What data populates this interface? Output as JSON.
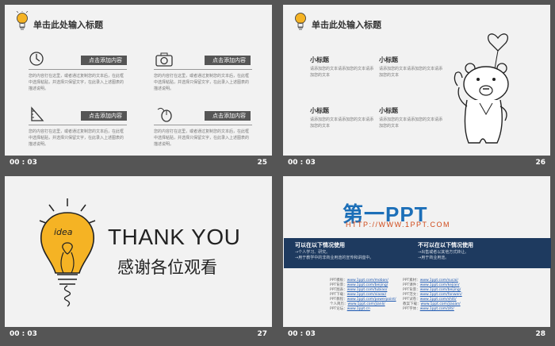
{
  "slides": [
    {
      "id": 25,
      "time": "00 : 03",
      "number": "25",
      "title": "单击此处输入标题",
      "features": [
        {
          "icon": "clock-icon",
          "tag": "点击添加内容",
          "text": "您的内容打在这里，或者通过复制您的文本后，在此框中选择粘贴，并选择只保留文字，在此录入上述图表的描述说明。"
        },
        {
          "icon": "camera-icon",
          "tag": "点击添加内容",
          "text": "您的内容打在这里，或者通过复制您的文本后，在此框中选择粘贴，并选择只保留文字，在此录入上述图表的描述说明。"
        },
        {
          "icon": "ruler-pencil-icon",
          "tag": "点击添加内容",
          "text": "您的内容打在这里，或者通过复制您的文本后，在此框中选择粘贴，并选择只保留文字，在此录入上述图表的描述说明。"
        },
        {
          "icon": "mouse-icon",
          "tag": "点击添加内容",
          "text": "您的内容打在这里，或者通过复制您的文本后，在此框中选择粘贴，并选择只保留文字，在此录入上述图表的描述说明。"
        }
      ]
    },
    {
      "id": 26,
      "time": "00 : 03",
      "number": "26",
      "title": "单击此处输入标题",
      "subs": [
        {
          "title": "小标题",
          "text": "请添加您的文本请添加您的文本请添加您的文本"
        },
        {
          "title": "小标题",
          "text": "请添加您的文本请添加您的文本请添加您的文本"
        },
        {
          "title": "小标题",
          "text": "请添加您的文本请添加您的文本请添加您的文本"
        },
        {
          "title": "小标题",
          "text": "请添加您的文本请添加您的文本请添加您的文本"
        }
      ]
    },
    {
      "id": 27,
      "time": "00 : 03",
      "number": "27",
      "thanks_en": "THANK YOU",
      "thanks_cn": "感谢各位观看",
      "bulb_word": "idea"
    },
    {
      "id": 28,
      "time": "00 : 03",
      "number": "28",
      "logo": "第一PPT",
      "url": "HTTP://WWW.1PPT.COM",
      "left_head": "可以在以下情况使用",
      "left_text": "→个人学习、研究。\n→用于教学中的非商业用途的宣传和讲座中。",
      "right_head": "不可以在以下情况使用",
      "right_text": "→出售或者以其他方式转让。\n→用于商业用途。",
      "links_left": [
        {
          "label": "PPT模板：",
          "url": "www.1ppt.com/moban/"
        },
        {
          "label": "PPT背景：",
          "url": "www.1ppt.com/beijing/"
        },
        {
          "label": "PPT图表：",
          "url": "www.1ppt.com/tubiao/"
        },
        {
          "label": "PPT下载：",
          "url": "www.1ppt.com/xiazai/"
        },
        {
          "label": "PPT教程：",
          "url": "www.1ppt.com/powerpoint/"
        },
        {
          "label": "个人简历：",
          "url": "www.1ppt.com/jianli/"
        },
        {
          "label": "PPT论坛：",
          "url": "www.1ppt.cn"
        }
      ],
      "links_right": [
        {
          "label": "PPT素材：",
          "url": "www.1ppt.com/sucai/"
        },
        {
          "label": "PPT课件：",
          "url": "www.1ppt.com/kejian/"
        },
        {
          "label": "PPT背景：",
          "url": "www.1ppt.com/beijing/"
        },
        {
          "label": "PPT范文：",
          "url": "www.1ppt.com/fanwen/"
        },
        {
          "label": "PPT试卷：",
          "url": "www.1ppt.com/shiti/"
        },
        {
          "label": "教案下载：",
          "url": "www.1ppt.com/jiaoan/"
        },
        {
          "label": "PPT字体：",
          "url": "www.1ppt.com/ziti/"
        }
      ]
    }
  ],
  "colors": {
    "background": "#555555",
    "slide": "#f2f2f2",
    "tag": "#555555",
    "bulb": "#f5b324",
    "brand_blue": "#1c6fb8",
    "band": "#1e3a5f"
  }
}
